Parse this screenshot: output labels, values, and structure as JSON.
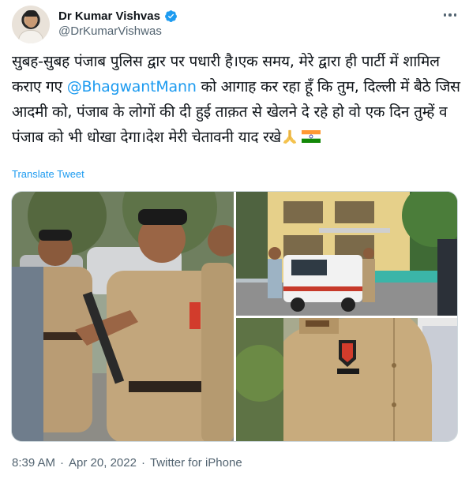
{
  "author": {
    "display_name": "Dr Kumar Vishvas",
    "handle": "@DrKumarVishwas",
    "verified": true
  },
  "icons": {
    "verified": "verified-badge-icon",
    "more": "more-options-icon",
    "pray": "folded-hands-emoji",
    "flag": "india-flag-emoji"
  },
  "tweet": {
    "text_before_mention": "सुबह-सुबह पंजाब पुलिस द्वार पर पधारी है।एक समय, मेरे द्वारा ही पार्टी में शामिल कराए गए ",
    "mention": "@BhagwantMann",
    "text_after_mention": " को आगाह कर रहा हूँ कि तुम, दिल्ली में बैठे जिस आदमी को, पंजाब के लोगों की दी हुई ताक़त से खेलने दे रहे हो वो एक दिन तुम्हें व पंजाब को भी धोखा देगा।देश मेरी चेतावनी याद रखे"
  },
  "translate_label": "Translate Tweet",
  "media": [
    {
      "alt": "Punjab police officers in khaki uniform standing outside"
    },
    {
      "alt": "Police vehicle parked outside a yellow residential building"
    },
    {
      "alt": "Close-up of police officer uniform with badge"
    }
  ],
  "footer": {
    "time": "8:39 AM",
    "separator1": "·",
    "date": "Apr 20, 2022",
    "separator2": "·",
    "source": "Twitter for iPhone"
  },
  "colors": {
    "link": "#1d9bf0",
    "secondary_text": "#536471",
    "primary_text": "#0f1419"
  }
}
